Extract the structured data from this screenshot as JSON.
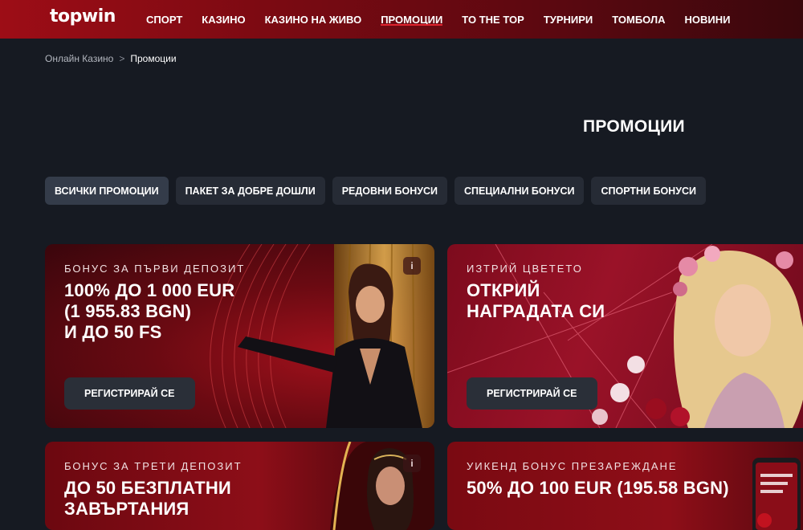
{
  "header": {
    "logo": "topwin",
    "nav": [
      {
        "label": "СПОРТ",
        "active": false
      },
      {
        "label": "КАЗИНО",
        "active": false
      },
      {
        "label": "КАЗИНО НА ЖИВО",
        "active": false
      },
      {
        "label": "ПРОМОЦИИ",
        "active": true
      },
      {
        "label": "TO THE TOP",
        "active": false
      },
      {
        "label": "ТУРНИРИ",
        "active": false
      },
      {
        "label": "ТОМБОЛА",
        "active": false
      },
      {
        "label": "НОВИНИ",
        "active": false
      }
    ]
  },
  "breadcrumb": {
    "parent": "Онлайн Казино",
    "separator": ">",
    "current": "Промоции"
  },
  "page_title": "ПРОМОЦИИ",
  "filters": [
    {
      "label": "ВСИЧКИ ПРОМОЦИИ",
      "active": true
    },
    {
      "label": "ПАКЕТ ЗА ДОБРЕ ДОШЛИ",
      "active": false
    },
    {
      "label": "РЕДОВНИ БОНУСИ",
      "active": false
    },
    {
      "label": "СПЕЦИАЛНИ БОНУСИ",
      "active": false
    },
    {
      "label": "СПОРТНИ БОНУСИ",
      "active": false
    }
  ],
  "cards": [
    {
      "eyebrow": "БОНУС ЗА ПЪРВИ ДЕПОЗИТ",
      "headline": "100% ДО 1 000 EUR\n(1 955.83 BGN)\nИ ДО 50 FS",
      "cta": "РЕГИСТРИРАЙ СЕ",
      "info_icon": "i"
    },
    {
      "eyebrow": "ИЗТРИЙ ЦВЕТЕТО",
      "headline": "ОТКРИЙ\nНАГРАДАТА СИ",
      "cta": "РЕГИСТРИРАЙ СЕ"
    },
    {
      "eyebrow": "БОНУС ЗА ТРЕТИ ДЕПОЗИТ",
      "headline": "ДО 50 БЕЗПЛАТНИ\nЗАВЪРТАНИЯ",
      "info_icon": "i"
    },
    {
      "eyebrow": "УИКЕНД БОНУС ПРЕЗАРЕЖДАНЕ",
      "headline": "50% ДО 100 EUR (195.58 BGN)"
    }
  ],
  "colors": {
    "header_red": "#9d0d16",
    "page_bg": "#161a22",
    "active_underline": "#e0242f",
    "button_bg": "#2a2f38"
  }
}
